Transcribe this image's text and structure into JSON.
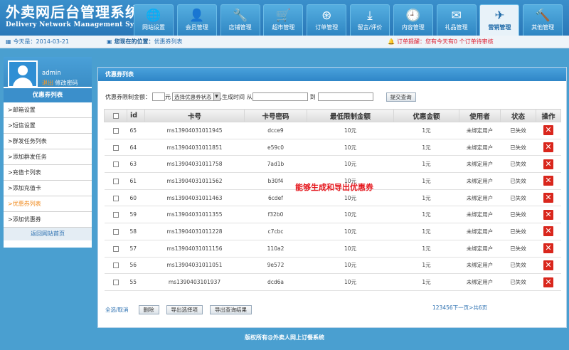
{
  "header": {
    "title_cn": "外卖网后台管理系统",
    "title_en": "Delivery Network Management System"
  },
  "nav": [
    {
      "label": "网站设置",
      "icon": "globe-icon",
      "glyph": "🌐"
    },
    {
      "label": "会员管理",
      "icon": "user-icon",
      "glyph": "👤"
    },
    {
      "label": "店铺管理",
      "icon": "tools-icon",
      "glyph": "🔧"
    },
    {
      "label": "超市管理",
      "icon": "cart-icon",
      "glyph": "🛒"
    },
    {
      "label": "订单管理",
      "icon": "film-reel-icon",
      "glyph": "⊛"
    },
    {
      "label": "留言/评价",
      "icon": "download-icon",
      "glyph": "⤓"
    },
    {
      "label": "内容管理",
      "icon": "clock-icon",
      "glyph": "🕘"
    },
    {
      "label": "礼品管理",
      "icon": "mail-icon",
      "glyph": "✉"
    },
    {
      "label": "营销管理",
      "icon": "plane-icon",
      "glyph": "✈"
    },
    {
      "label": "其他管理",
      "icon": "hammer-icon",
      "glyph": "🔨"
    }
  ],
  "active_nav": 8,
  "infobar": {
    "today": "今天是：2014-03-21",
    "location_label": "您现在的位置：",
    "location": "优惠券列表",
    "alert": "订单提醒：您有今天有0 个订单待审核"
  },
  "sidebar": {
    "username": "admin",
    "logout": "退出",
    "change_password": "修改密码",
    "title": "优惠券列表",
    "items": [
      ">邮箱设置",
      ">短信设置",
      ">群发任务列表",
      ">添加群发任务",
      ">充值卡列表",
      ">添加充值卡",
      ">优惠券列表",
      ">添加优惠券"
    ],
    "active_index": 6,
    "footer": "返回网站首页"
  },
  "panel": {
    "title": "优惠券列表",
    "filter": {
      "min_amount_label": "优惠券限制金额：",
      "unit": "元",
      "status_select": "选择优惠券状态",
      "time_label": ",生成时间 从",
      "to_label": "到",
      "submit": "提交查询"
    },
    "columns": [
      "id",
      "卡号",
      "卡号密码",
      "最低限制金额",
      "优惠金额",
      "使用者",
      "状态",
      "操作"
    ],
    "rows": [
      {
        "id": "65",
        "card": "ms13904031011945",
        "pwd": "dcce9",
        "min": "10元",
        "amount": "1元",
        "user": "未绑定用户",
        "status": "已失效"
      },
      {
        "id": "64",
        "card": "ms13904031011851",
        "pwd": "e59c0",
        "min": "10元",
        "amount": "1元",
        "user": "未绑定用户",
        "status": "已失效"
      },
      {
        "id": "63",
        "card": "ms13904031011758",
        "pwd": "7ad1b",
        "min": "10元",
        "amount": "1元",
        "user": "未绑定用户",
        "status": "已失效"
      },
      {
        "id": "61",
        "card": "ms13904031011562",
        "pwd": "b30f4",
        "min": "10元",
        "amount": "1元",
        "user": "未绑定用户",
        "status": "已失效"
      },
      {
        "id": "60",
        "card": "ms13904031011463",
        "pwd": "6cdef",
        "min": "10元",
        "amount": "1元",
        "user": "未绑定用户",
        "status": "已失效"
      },
      {
        "id": "59",
        "card": "ms13904031011355",
        "pwd": "f32b0",
        "min": "10元",
        "amount": "1元",
        "user": "未绑定用户",
        "status": "已失效"
      },
      {
        "id": "58",
        "card": "ms13904031011228",
        "pwd": "c7cbc",
        "min": "10元",
        "amount": "1元",
        "user": "未绑定用户",
        "status": "已失效"
      },
      {
        "id": "57",
        "card": "ms13904031011156",
        "pwd": "110a2",
        "min": "10元",
        "amount": "1元",
        "user": "未绑定用户",
        "status": "已失效"
      },
      {
        "id": "56",
        "card": "ms13904031011051",
        "pwd": "9e572",
        "min": "10元",
        "amount": "1元",
        "user": "未绑定用户",
        "status": "已失效"
      },
      {
        "id": "55",
        "card": "ms1390403101937",
        "pwd": "dcd6a",
        "min": "10元",
        "amount": "1元",
        "user": "未绑定用户",
        "status": "已失效"
      }
    ],
    "annotation": "能够生成和导出优惠券",
    "bottom": {
      "select_all": "全选/取消",
      "delete": "删除",
      "export_selected": "导出选择项",
      "export_results": "导出查询结果"
    },
    "pager": "123456下一页>共6页"
  },
  "footer": "版权所有@外卖人网上订餐系统"
}
